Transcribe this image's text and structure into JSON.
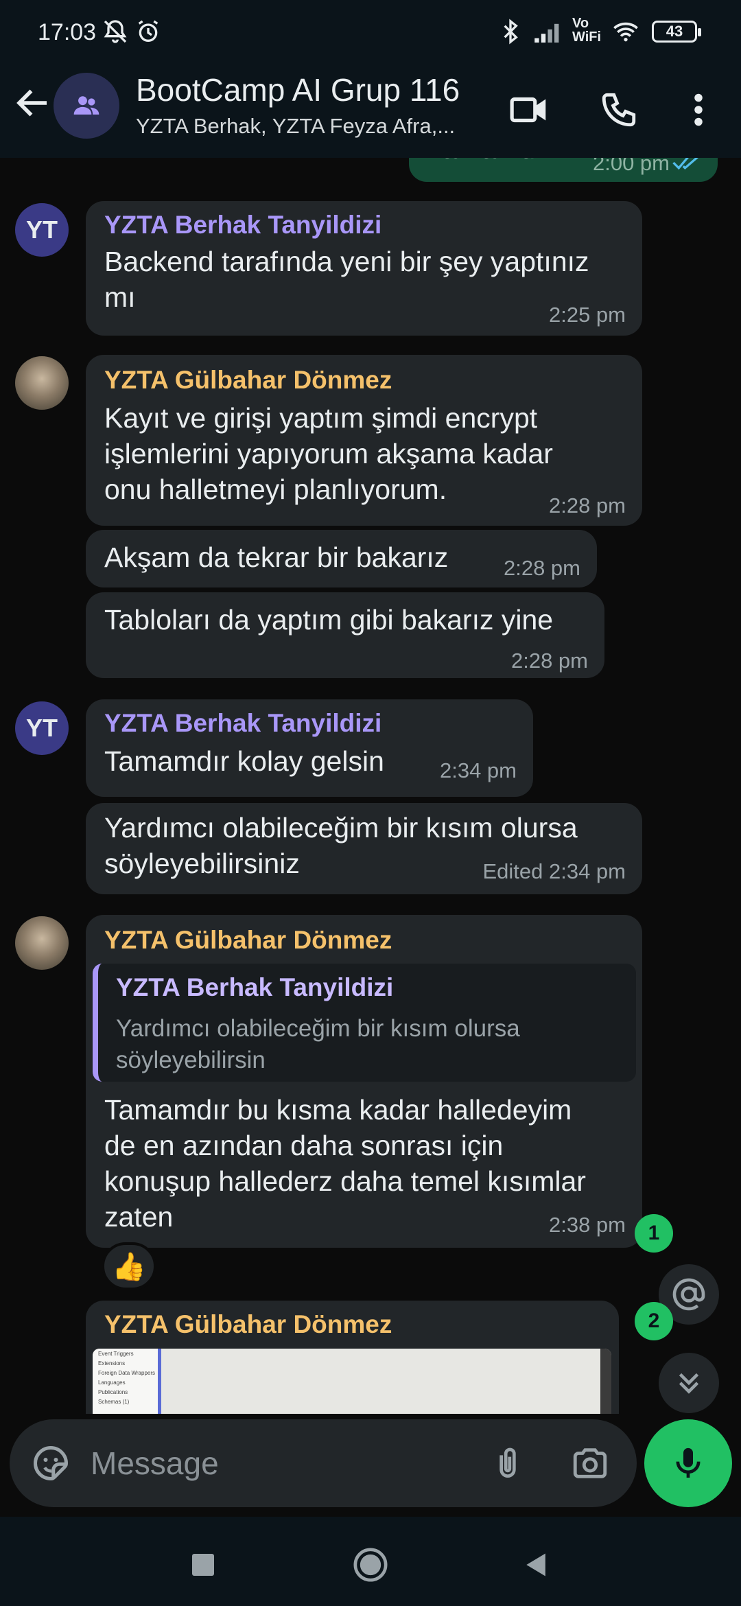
{
  "status_bar": {
    "time": "17:03",
    "battery": "43",
    "network_label": "Vo WiFi"
  },
  "header": {
    "title": "BootCamp AI Grup 116",
    "subtitle": "YZTA Berhak, YZTA Feyza Afra,..."
  },
  "messages": {
    "top_outgoing": {
      "text": "Tamamdır",
      "time": "2:00 pm"
    },
    "m1": {
      "avatar": "YT",
      "sender": "YZTA Berhak Tanyildizi",
      "lines": [
        "Backend tarafında yeni bir şey yaptınız",
        "mı"
      ],
      "time": "2:25 pm"
    },
    "m2": {
      "sender": "YZTA Gülbahar Dönmez",
      "lines": [
        "Kayıt ve girişi yaptım şimdi encrypt",
        "işlemlerini yapıyorum akşama kadar",
        "onu halletmeyi planlıyorum."
      ],
      "time": "2:28 pm"
    },
    "m3": {
      "text": "Akşam da tekrar bir bakarız",
      "time": "2:28 pm"
    },
    "m4": {
      "text": "Tabloları da yaptım gibi bakarız yine",
      "time": "2:28 pm"
    },
    "m5": {
      "avatar": "YT",
      "sender": "YZTA Berhak Tanyildizi",
      "text": "Tamamdır kolay gelsin",
      "time": "2:34 pm"
    },
    "m6": {
      "lines": [
        "Yardımcı olabileceğim bir kısım olursa",
        "söyleyebilirsiniz"
      ],
      "time": "Edited 2:34 pm"
    },
    "m7": {
      "sender": "YZTA Gülbahar Dönmez",
      "quote_sender": "YZTA Berhak Tanyildizi",
      "quote_lines": [
        "Yardımcı olabileceğim bir kısım olursa",
        "söyleyebilirsin"
      ],
      "lines": [
        "Tamamdır bu kısma kadar halledeyim",
        "de en azından daha sonrası için",
        "konuşup hallederz daha temel kısımlar",
        "zaten"
      ],
      "time": "2:38 pm",
      "reaction": "👍"
    },
    "m8": {
      "sender": "YZTA Gülbahar Dönmez",
      "image_sidebar_items": [
        "Event Triggers",
        "Extensions",
        "Foreign Data Wrappers",
        "Languages",
        "Publications",
        "Schemas (1)"
      ]
    }
  },
  "fabs": {
    "mentions_badge": "1",
    "scroll_badge": "2"
  },
  "input": {
    "placeholder": "Message"
  },
  "colors": {
    "accent_green": "#21c063",
    "sender_purple": "#a997f8",
    "sender_yellow": "#f5c16b",
    "bubble_bg": "#222629"
  }
}
